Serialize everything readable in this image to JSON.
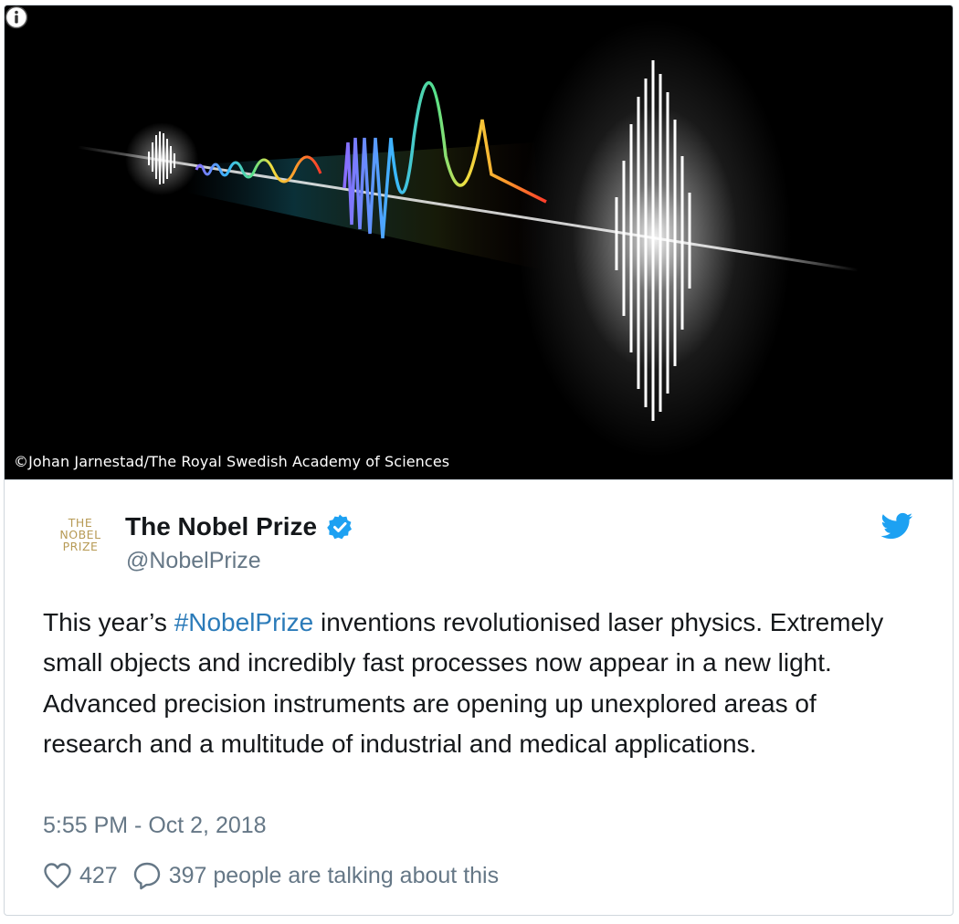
{
  "media": {
    "caption": "©Johan Jarnestad/The Royal Swedish Academy of Sciences",
    "info_icon": "info-icon"
  },
  "author": {
    "avatar_lines": [
      "THE",
      "NOBEL",
      "PRIZE"
    ],
    "name": "The Nobel Prize",
    "handle": "@NobelPrize",
    "verified_icon": "verified-badge-icon"
  },
  "tweet": {
    "text_before": "This year’s ",
    "hashtag": "#NobelPrize",
    "text_after": " inventions revolutionised laser physics. Extremely small objects and incredibly fast processes now appear in a new light. Advanced precision instruments are opening up unexplored areas of research and a multitude of industrial and medical applications.",
    "timestamp": "5:55 PM - Oct 2, 2018"
  },
  "actions": {
    "likes": "427",
    "talking": "397 people are talking about this",
    "like_icon": "heart-icon",
    "reply_icon": "speech-bubble-icon"
  },
  "colors": {
    "link": "#2b7bb9",
    "twitter_blue": "#1da1f2",
    "secondary_text": "#657786",
    "avatar_gold": "#b79a55"
  }
}
